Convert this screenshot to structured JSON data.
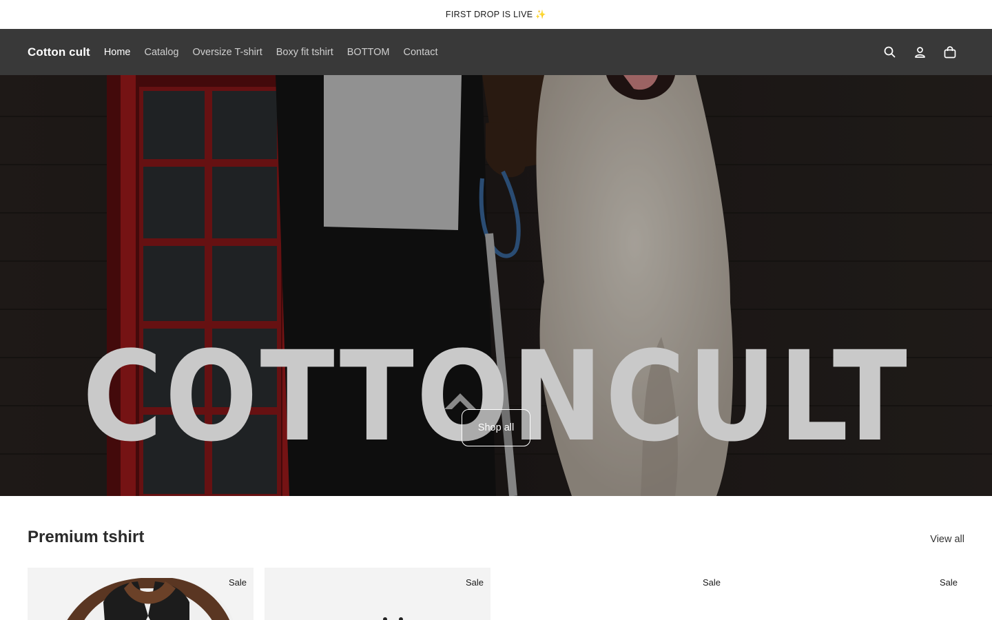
{
  "announcement": {
    "text": "FIRST DROP IS LIVE ✨"
  },
  "header": {
    "logo": "Cotton cult",
    "nav": [
      {
        "label": "Home",
        "active": true
      },
      {
        "label": "Catalog"
      },
      {
        "label": "Oversize T-shirt"
      },
      {
        "label": "Boxy fit tshirt"
      },
      {
        "label": "BOTTOM"
      },
      {
        "label": "Contact"
      }
    ],
    "icons": [
      "search-icon",
      "account-icon",
      "cart-icon"
    ]
  },
  "hero": {
    "title": "COTTONCULT",
    "button_label": "Shop all"
  },
  "collection": {
    "title": "Premium tshirt",
    "view_all": "View all",
    "products": [
      {
        "badge": "Sale"
      },
      {
        "badge": "Sale"
      },
      {
        "badge": "Sale"
      },
      {
        "badge": "Sale"
      }
    ]
  },
  "colors": {
    "header_bg": "#393939",
    "hero_text": "#c9c9c9"
  }
}
